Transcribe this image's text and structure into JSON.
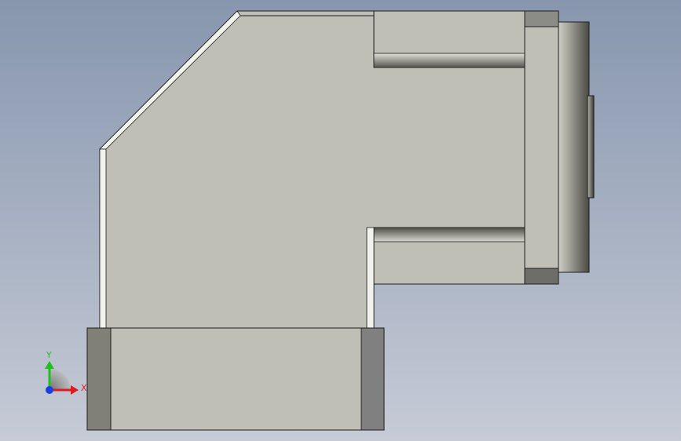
{
  "viewport": {
    "background_top": "#8796ae",
    "background_bottom": "#c6cbd6"
  },
  "part": {
    "face_color": "#bfbfb5",
    "edge_color": "#1e1e1e",
    "shade_dark": "#808080",
    "shade_mid": "#9a9a92",
    "highlight": "#f2f2ec"
  },
  "triad": {
    "x_label": "X",
    "y_label": "Y",
    "x_color": "#e01b1b",
    "y_color": "#1fbf1f",
    "z_color": "#1b3ee0"
  }
}
